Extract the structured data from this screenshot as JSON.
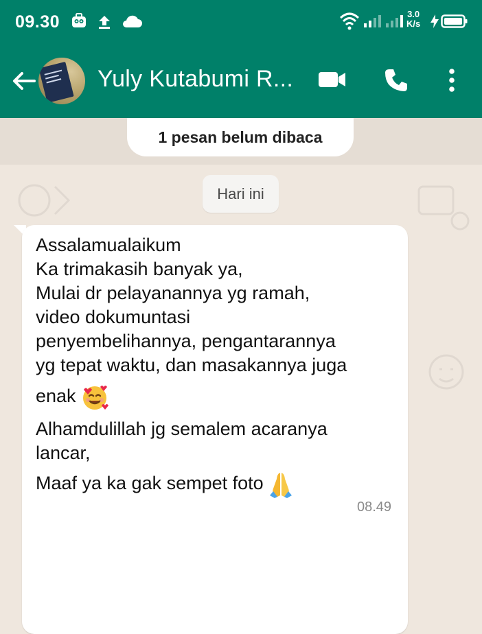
{
  "status_bar": {
    "time": "09.30",
    "net_speed_value": "3.0",
    "net_speed_unit": "K/s"
  },
  "header": {
    "contact_name": "Yuly Kutabumi R...",
    "colors": {
      "header_bg": "#008069",
      "chat_bg": "#efe7de"
    },
    "icons": [
      "back-arrow-icon",
      "video-call-icon",
      "phone-icon",
      "more-vert-icon"
    ]
  },
  "chat": {
    "unread_banner": "1 pesan belum dibaca",
    "date_divider": "Hari ini",
    "message": {
      "lines": [
        "Assalamualaikum",
        "Ka trimakasih banyak ya,",
        "Mulai dr pelayanannya yg ramah,",
        "video dokumuntasi",
        "penyembelihannya, pengantarannya",
        "yg tepat waktu, dan masakannya juga",
        "enak",
        "Alhamdulillah jg semalem acaranya",
        "lancar,",
        "Maaf ya ka gak sempet foto"
      ],
      "emoji_after_enak": "smiling-face-with-hearts",
      "emoji_after_foto": "folded-hands",
      "time": "08.49"
    }
  }
}
